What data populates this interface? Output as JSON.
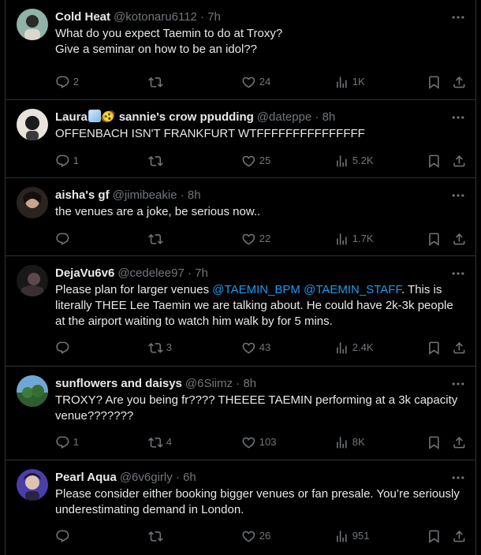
{
  "icons": {
    "reply": "reply-icon",
    "retweet": "retweet-icon",
    "like": "heart-icon",
    "views": "views-icon",
    "bookmark": "bookmark-icon",
    "share": "share-icon",
    "more": "more-icon"
  },
  "colors": {
    "background": "#000000",
    "border": "#2f3336",
    "text": "#e7e9ea",
    "muted": "#71767b",
    "mention": "#1d9bf0"
  },
  "tweets": [
    {
      "name": "Cold Heat",
      "handle": "@kotonaru6112",
      "dot": "·",
      "time": "7h",
      "text": "What do you expect Taemin to do at Troxy?\nGive a seminar on how to be an idol??",
      "replies": "2",
      "retweets": "",
      "likes": "24",
      "views": "1K"
    },
    {
      "name": "Laura",
      "name_emoji": "🧊😵‍💫",
      "name_rest": " sannie's crow ppudding",
      "handle": "@dateppe",
      "dot": "·",
      "time": "8h",
      "text": "OFFENBACH ISN'T FRANKFURT WTFFFFFFFFFFFFFFF",
      "replies": "1",
      "retweets": "",
      "likes": "25",
      "views": "5.2K"
    },
    {
      "name": "aisha's gf",
      "handle": "@jimibeakie",
      "dot": "·",
      "time": "8h",
      "text": "the venues are a joke, be serious now..",
      "replies": "",
      "retweets": "",
      "likes": "22",
      "views": "1.7K"
    },
    {
      "name": "DejaVu6v6",
      "handle": "@cedelee97",
      "dot": "·",
      "time": "7h",
      "text_before": "Please plan for larger venues ",
      "mention1": "@TAEMIN_BPM",
      "text_mid": " ",
      "mention2": "@TAEMIN_STAFF",
      "text_after": ". This is literally THEE Lee Taemin we are talking about. He could have 2k-3k people at the airport waiting to watch him walk by for 5 mins.",
      "replies": "",
      "retweets": "3",
      "likes": "43",
      "views": "2.4K"
    },
    {
      "name": "sunflowers and daisys",
      "handle": "@6Siimz",
      "dot": "·",
      "time": "8h",
      "text": "TROXY? Are you being fr???? THEEEE TAEMIN performing at a 3k capacity venue???????",
      "replies": "1",
      "retweets": "4",
      "likes": "103",
      "views": "8K"
    },
    {
      "name": "Pearl Aqua",
      "handle": "@6v6girly",
      "dot": "·",
      "time": "6h",
      "text": "Please consider either booking bigger venues or fan presale. You’re seriously underestimating demand in London.",
      "replies": "",
      "retweets": "",
      "likes": "26",
      "views": "951"
    }
  ]
}
